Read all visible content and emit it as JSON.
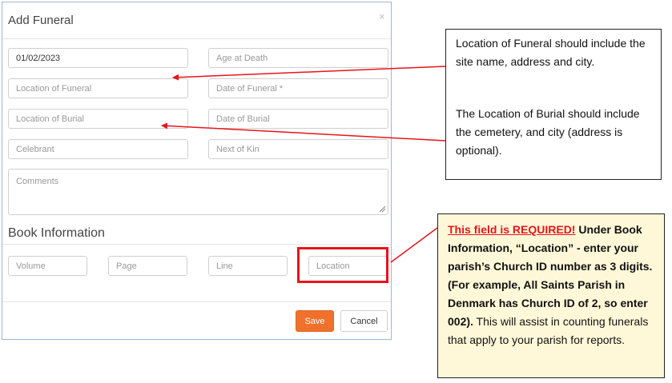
{
  "dialog": {
    "title": "Add Funeral",
    "close_glyph": "×",
    "fields": {
      "date_value": "01/02/2023",
      "age_at_death_placeholder": "Age at Death",
      "location_of_funeral_placeholder": "Location of Funeral",
      "date_of_funeral_placeholder": "Date of Funeral *",
      "location_of_burial_placeholder": "Location of Burial",
      "date_of_burial_placeholder": "Date of Burial",
      "celebrant_placeholder": "Celebrant",
      "next_of_kin_placeholder": "Next of Kin",
      "comments_placeholder": "Comments"
    },
    "book_information": {
      "title": "Book Information",
      "volume_placeholder": "Volume",
      "page_placeholder": "Page",
      "line_placeholder": "Line",
      "location_placeholder": "Location"
    },
    "save_label": "Save",
    "cancel_label": "Cancel"
  },
  "annotations": {
    "funeral_note": "Location of Funeral should include the site name, address and city.",
    "burial_note": "The Location of Burial should include the cemetery, and city (address is optional).",
    "required_note": {
      "highlight": "This field is REQUIRED!",
      "bold_part": " Under Book Information, “Location” - enter your parish’s Church ID number as 3 digits. (For example, All Saints Parish in Denmark has Church ID of 2, so enter 002).",
      "normal_part": " This will assist in counting funerals that apply to your parish for reports."
    }
  },
  "colors": {
    "save_button": "#f0712b",
    "highlight_red": "#e8141b",
    "note_background": "#fff8d8",
    "dialog_border": "#9eb7cf"
  }
}
